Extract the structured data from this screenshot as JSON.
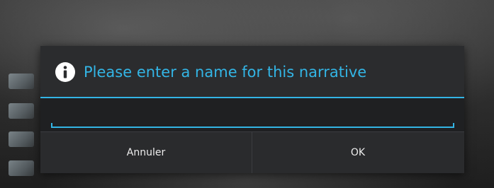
{
  "dialog": {
    "title": "Please enter a name for this narrative",
    "title_icon": "info-icon",
    "input": {
      "value": "",
      "placeholder": ""
    },
    "buttons": {
      "cancel_label": "Annuler",
      "ok_label": "OK"
    }
  },
  "colors": {
    "accent": "#33b5e5",
    "dialog_background": "#2a2b2d",
    "button_text": "#ededed"
  }
}
